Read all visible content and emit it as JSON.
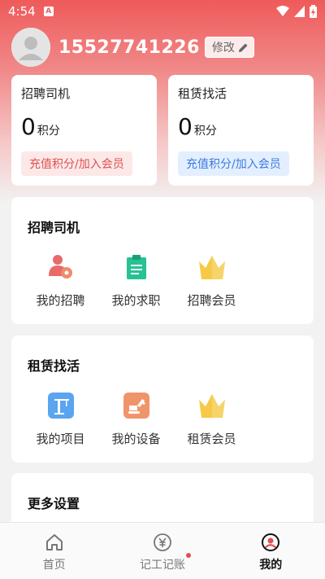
{
  "status_bar": {
    "time": "4:54",
    "badge": "A"
  },
  "profile": {
    "phone": "15527741226",
    "edit_label": "修改"
  },
  "recruit_card": {
    "title": "招聘司机",
    "points": "0",
    "unit": "积分",
    "button": "充值积分/加入会员",
    "accent": "#e05050"
  },
  "rental_card": {
    "title": "租赁找活",
    "points": "0",
    "unit": "积分",
    "button": "充值积分/加入会员",
    "accent": "#3b7be0"
  },
  "recruit_section": {
    "title": "招聘司机",
    "items": [
      {
        "label": "我的招聘",
        "icon": "user-gear-icon"
      },
      {
        "label": "我的求职",
        "icon": "clipboard-icon"
      },
      {
        "label": "招聘会员",
        "icon": "crown-icon"
      }
    ]
  },
  "rental_section": {
    "title": "租赁找活",
    "items": [
      {
        "label": "我的项目",
        "icon": "crane-icon"
      },
      {
        "label": "我的设备",
        "icon": "excavator-icon"
      },
      {
        "label": "租赁会员",
        "icon": "crown-icon"
      }
    ]
  },
  "more_section": {
    "title": "更多设置"
  },
  "tabbar": {
    "tabs": [
      {
        "label": "首页",
        "icon": "home-icon"
      },
      {
        "label": "记工记账",
        "icon": "yuan-icon"
      },
      {
        "label": "我的",
        "icon": "profile-icon"
      }
    ],
    "active": "我的"
  }
}
